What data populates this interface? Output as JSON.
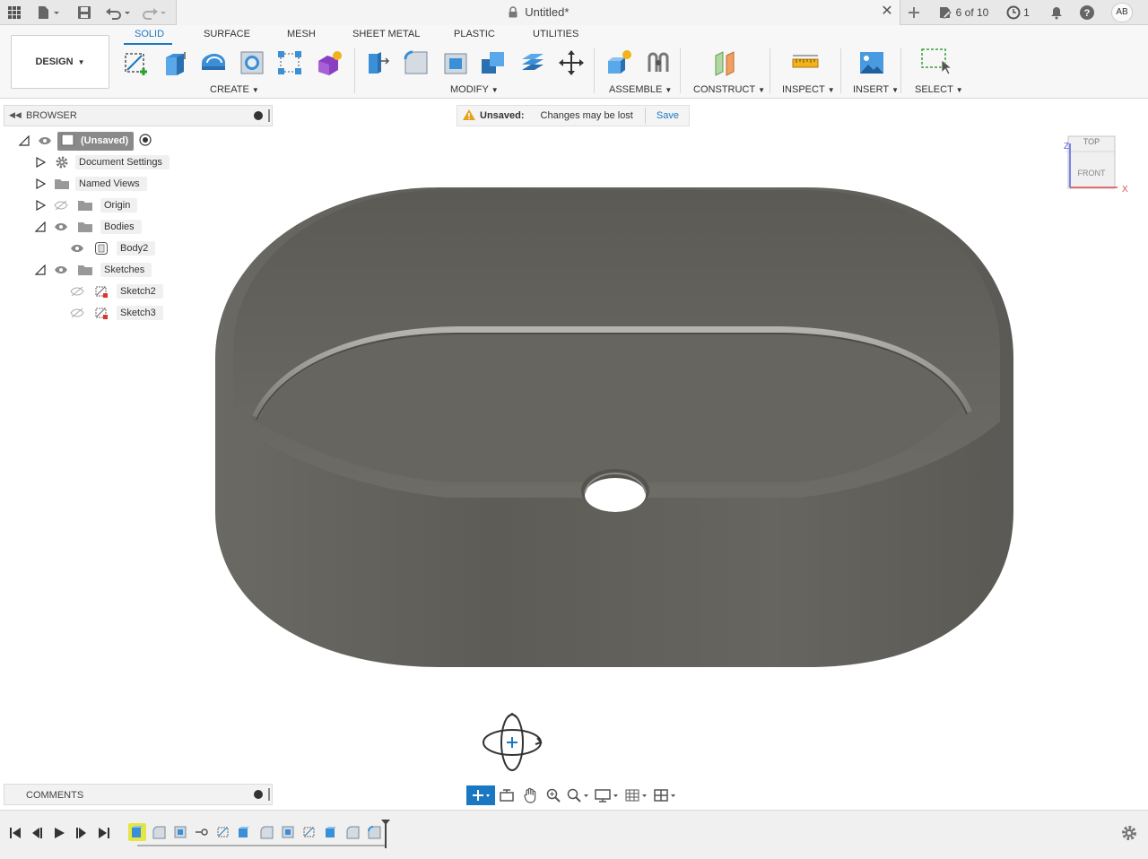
{
  "titlebar": {
    "document_title": "Untitled*",
    "version_counter": "6 of 10",
    "job_count": "1",
    "avatar_initials": "AB"
  },
  "ribbon": {
    "workspace_label": "DESIGN",
    "tabs": [
      "SOLID",
      "SURFACE",
      "MESH",
      "SHEET METAL",
      "PLASTIC",
      "UTILITIES"
    ],
    "active_tab": "SOLID",
    "groups": {
      "create": "CREATE",
      "modify": "MODIFY",
      "assemble": "ASSEMBLE",
      "construct": "CONSTRUCT",
      "inspect": "INSPECT",
      "insert": "INSERT",
      "select": "SELECT"
    }
  },
  "browser": {
    "title": "BROWSER",
    "items": [
      {
        "label": "(Unsaved)"
      },
      {
        "label": "Document Settings"
      },
      {
        "label": "Named Views"
      },
      {
        "label": "Origin"
      },
      {
        "label": "Bodies"
      },
      {
        "label": "Body2"
      },
      {
        "label": "Sketches"
      },
      {
        "label": "Sketch2"
      },
      {
        "label": "Sketch3"
      }
    ]
  },
  "banner": {
    "status": "Unsaved:",
    "message": "Changes may be lost",
    "action": "Save"
  },
  "viewcube": {
    "top": "TOP",
    "front": "FRONT",
    "axis_z": "Z",
    "axis_x": "X"
  },
  "comments": {
    "title": "COMMENTS"
  },
  "colors": {
    "accent": "#1a78c2",
    "model": "#6a6863",
    "warning": "#e8a21a"
  }
}
